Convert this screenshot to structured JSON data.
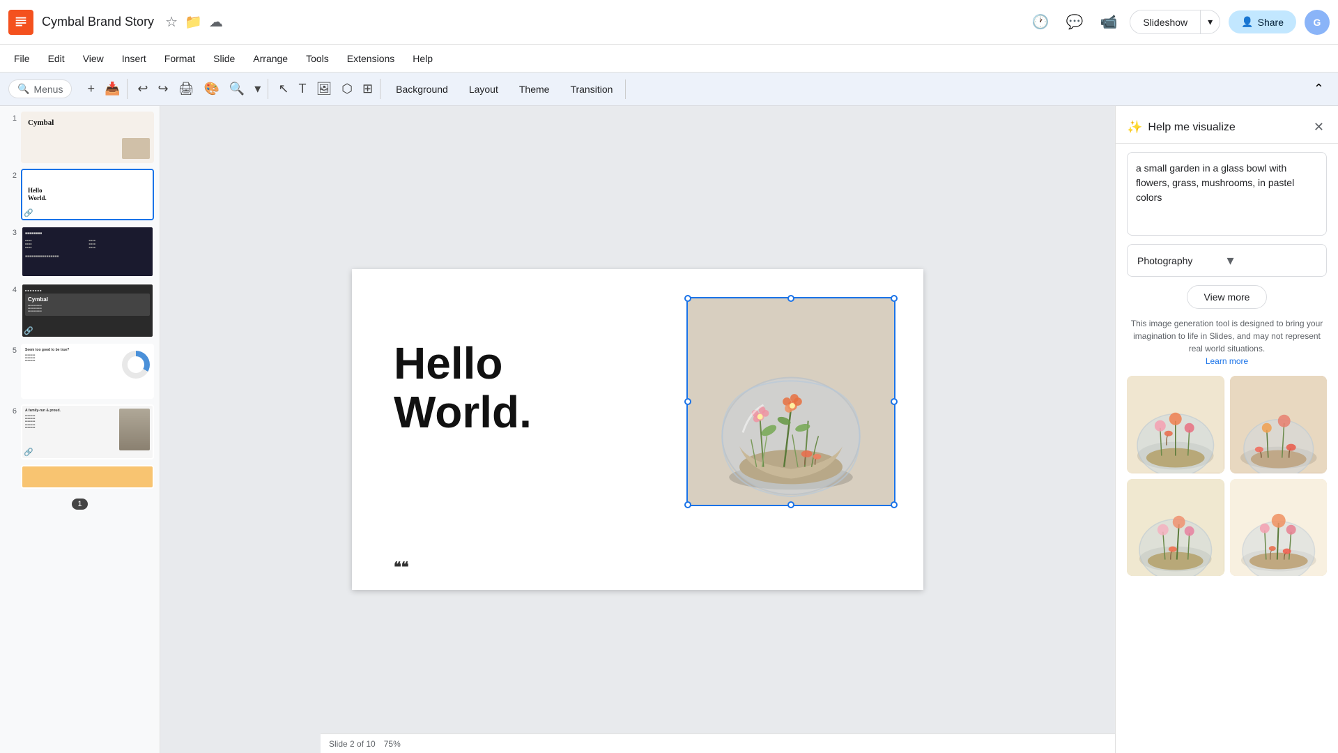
{
  "app": {
    "logo_bg": "#f4511e",
    "doc_title": "Cymbal Brand Story"
  },
  "top_bar": {
    "slideshow_label": "Slideshow",
    "share_label": "Share",
    "share_icon": "👤"
  },
  "menu_bar": {
    "items": [
      "File",
      "Edit",
      "View",
      "Insert",
      "Format",
      "Slide",
      "Arrange",
      "Tools",
      "Extensions",
      "Help"
    ]
  },
  "toolbar": {
    "search_placeholder": "Menus",
    "buttons": [
      "↩",
      "↪",
      "🖨",
      "⊞",
      "🔍"
    ],
    "style_buttons": [
      "Background",
      "Layout",
      "Theme",
      "Transition"
    ]
  },
  "slides": [
    {
      "num": "1",
      "label": "Cymbal slide 1",
      "type": "cymbal"
    },
    {
      "num": "2",
      "label": "Hello World slide",
      "type": "hello_world",
      "active": true
    },
    {
      "num": "3",
      "label": "Dark slide 3",
      "type": "dark1"
    },
    {
      "num": "4",
      "label": "Dark slide 4",
      "type": "dark2"
    },
    {
      "num": "5",
      "label": "Pie chart slide",
      "type": "chart"
    },
    {
      "num": "6",
      "label": "Family slide",
      "type": "family"
    }
  ],
  "canvas": {
    "slide_text_line1": "Hello",
    "slide_text_line2": "World.",
    "footer_symbol": "❝❝"
  },
  "right_panel": {
    "title": "Help me visualize",
    "prompt_text": "a small garden in a glass bowl with flowers, grass, mushrooms, in pastel colors",
    "style_label": "Photography",
    "view_more_label": "View more",
    "disclaimer": "This image generation tool is designed to bring your imagination to life in Slides, and may not represent real world situations.",
    "learn_more": "Learn more"
  }
}
